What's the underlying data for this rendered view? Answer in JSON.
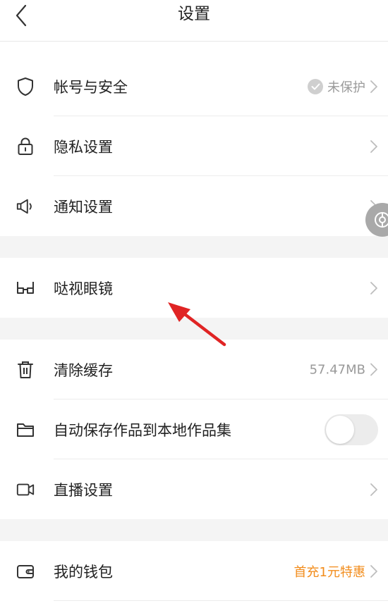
{
  "header": {
    "title": "设置"
  },
  "account": {
    "label": "帐号与安全",
    "status": "未保护"
  },
  "privacy": {
    "label": "隐私设置"
  },
  "notify": {
    "label": "通知设置"
  },
  "glasses": {
    "label": "哒视眼镜"
  },
  "cache": {
    "label": "清除缓存",
    "size": "57.47MB"
  },
  "autosave": {
    "label": "自动保存作品到本地作品集",
    "enabled": false
  },
  "live": {
    "label": "直播设置"
  },
  "wallet": {
    "label": "我的钱包",
    "promo": "首充1元特惠"
  },
  "colors": {
    "accent_orange": "#f28c1b",
    "arrow_red": "#e02424",
    "toggle_off": "#ececec"
  }
}
